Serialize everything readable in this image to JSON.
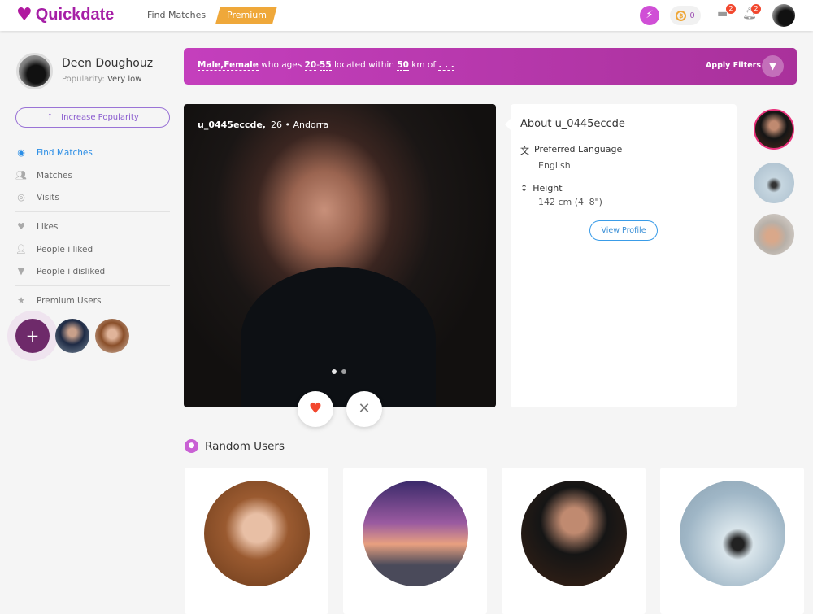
{
  "header": {
    "brand": "Quickdate",
    "nav_find_matches": "Find Matches",
    "premium": "Premium",
    "coins": "0",
    "messages_badge": "2",
    "notifications_badge": "2"
  },
  "user": {
    "name": "Deen Doughouz",
    "popularity_label": "Popularity:",
    "popularity_value": "Very low",
    "increase_popularity": "Increase Popularity"
  },
  "sidebar": {
    "items": [
      {
        "label": "Find Matches",
        "icon": "compass-icon",
        "active": true
      },
      {
        "label": "Matches",
        "icon": "users-check-icon"
      },
      {
        "label": "Visits",
        "icon": "eye-icon"
      },
      {
        "label": "Likes",
        "icon": "heart-icon"
      },
      {
        "label": "People i liked",
        "icon": "user-like-icon"
      },
      {
        "label": "People i disliked",
        "icon": "thumbs-down-icon"
      },
      {
        "label": "Premium Users",
        "icon": "star-icon"
      }
    ]
  },
  "filter": {
    "gender": "Male,Female",
    "who_ages": "who ages",
    "age_from": "20",
    "age_to": "55",
    "located_within": "located within",
    "distance": "50",
    "km_of": "km of",
    "location": ". . .",
    "apply": "Apply Filters"
  },
  "match": {
    "username": "u_0445eccde,",
    "age": "26",
    "country": "Andorra"
  },
  "about": {
    "title": "About u_0445eccde",
    "language_label": "Preferred Language",
    "language_value": "English",
    "height_label": "Height",
    "height_value": "142 cm (4' 8\")",
    "view_profile": "View Profile"
  },
  "random_users": {
    "title": "Random Users"
  },
  "colors": {
    "brand": "#a61fa6",
    "premium": "#efa83a",
    "active": "#2b8ee6",
    "filter_bar": "#c43fbd",
    "like": "#f2472e"
  }
}
